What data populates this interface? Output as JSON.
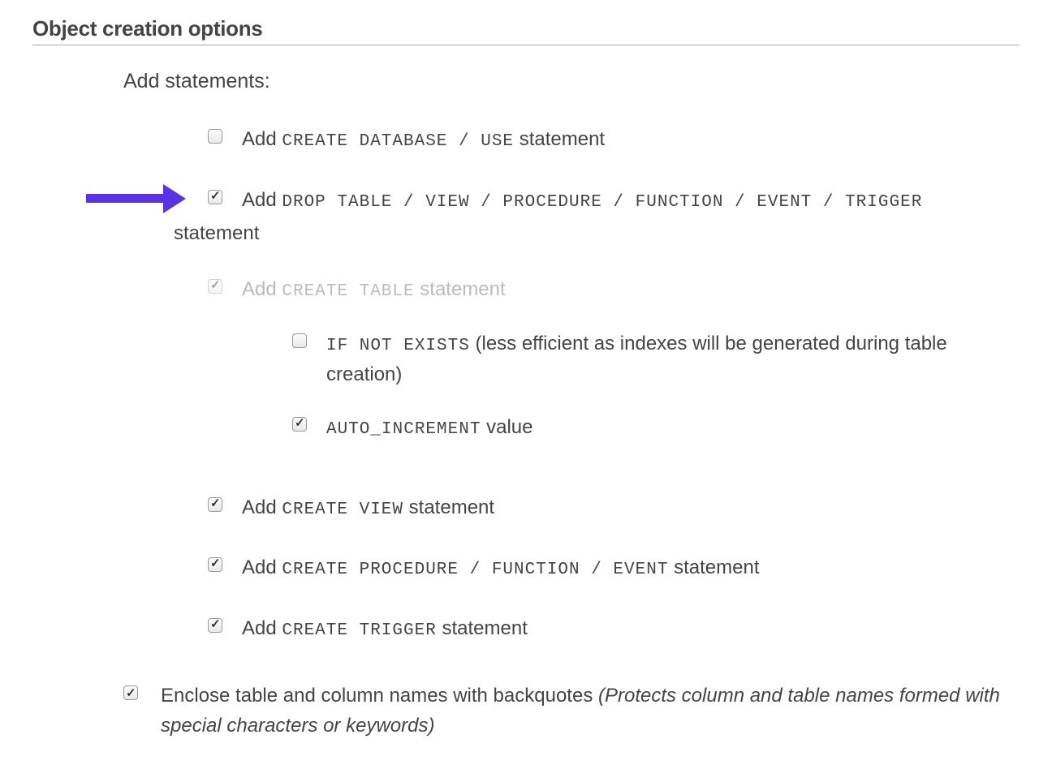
{
  "heading": "Object creation options",
  "group_label": "Add statements:",
  "options": {
    "create_db": {
      "pre": "Add ",
      "code": "CREATE DATABASE / USE",
      "post": " statement",
      "checked": false
    },
    "drop_table": {
      "pre": "Add ",
      "code": "DROP TABLE / VIEW / PROCEDURE / FUNCTION / EVENT / TRIGGER",
      "post": "",
      "continuation": "statement",
      "checked": true
    },
    "create_table": {
      "pre": "Add ",
      "code": "CREATE TABLE",
      "post": " statement",
      "checked": true,
      "disabled": true
    },
    "if_not_exists": {
      "pre": "",
      "code": "IF NOT EXISTS",
      "post": " (less efficient as indexes will be generated during table creation)",
      "checked": false
    },
    "auto_increment": {
      "pre": "",
      "code": "AUTO_INCREMENT",
      "post": " value",
      "checked": true
    },
    "create_view": {
      "pre": "Add ",
      "code": "CREATE VIEW",
      "post": " statement",
      "checked": true
    },
    "create_proc": {
      "pre": "Add ",
      "code": "CREATE PROCEDURE / FUNCTION / EVENT",
      "post": " statement",
      "checked": true
    },
    "create_trigger": {
      "pre": "Add ",
      "code": "CREATE TRIGGER",
      "post": " statement",
      "checked": true
    }
  },
  "enclose": {
    "text": "Enclose table and column names with backquotes ",
    "note": "(Protects column and table names formed with special characters or keywords)",
    "checked": true
  }
}
